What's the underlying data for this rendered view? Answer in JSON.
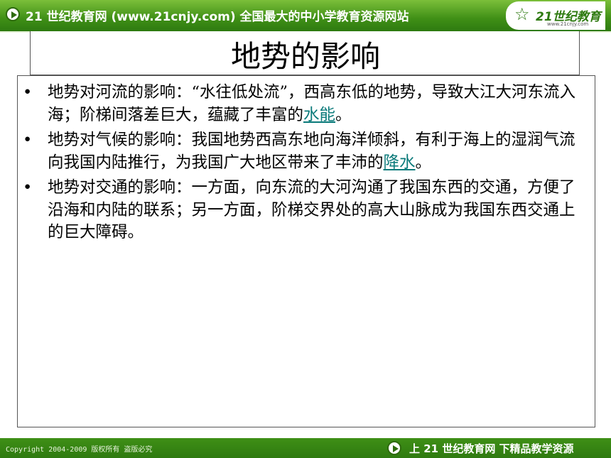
{
  "header": {
    "site_title": "21 世纪教育网 (www.21cnjy.com)  全国最大的中小学教育资源网站",
    "play_icon": "play-circle-icon",
    "logo": {
      "text": "21世纪教育",
      "url": "www.21cnjy.com"
    }
  },
  "slide": {
    "title": "地势的影响",
    "bullets": [
      {
        "text_before": "地势对河流的影响：“水往低处流”，西高东低的地势，导致大江大河东流入海；阶梯间落差巨大，蕴藏了丰富的",
        "link": "水能",
        "text_after": "。"
      },
      {
        "text_before": "地势对气候的影响：我国地势西高东地向海洋倾斜，有利于海上的湿润气流向我国内陆推行，为我国广大地区带来了丰沛的",
        "link": "降水",
        "text_after": "。"
      },
      {
        "text_before": "地势对交通的影响：一方面，向东流的大河沟通了我国东西的交通，方便了沿海和内陆的联系；另一方面，阶梯交界处的高大山脉成为我国东西交通上的巨大障碍。",
        "link": "",
        "text_after": ""
      }
    ],
    "link_color": "#0a7a7a"
  },
  "footer": {
    "copyright": "Copyright 2004-2009 版权所有 盗版必究",
    "slogan": "上 21 世纪教育网   下精品教学资源",
    "play_icon": "play-circle-icon"
  },
  "colors": {
    "bar_green": "#3f8f16",
    "text": "#000000"
  }
}
